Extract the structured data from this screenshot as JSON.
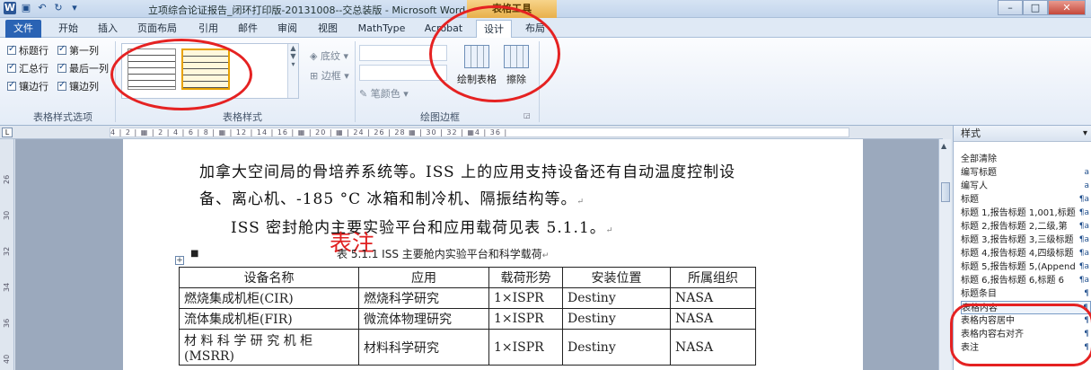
{
  "window": {
    "title": "立项综合论证报告_闭环打印版-20131008--交总装版 - Microsoft Word",
    "context_tab_title": "表格工具",
    "qat_icons": [
      "word-icon",
      "save-icon",
      "undo-icon",
      "redo-icon",
      "customize-icon"
    ]
  },
  "tabs": [
    {
      "label": "文件"
    },
    {
      "label": "开始"
    },
    {
      "label": "插入"
    },
    {
      "label": "页面布局"
    },
    {
      "label": "引用"
    },
    {
      "label": "邮件"
    },
    {
      "label": "审阅"
    },
    {
      "label": "视图"
    },
    {
      "label": "MathType"
    },
    {
      "label": "Acrobat"
    },
    {
      "label": "设计"
    },
    {
      "label": "布局"
    }
  ],
  "ribbon": {
    "style_options": {
      "label": "表格样式选项",
      "checks": [
        {
          "label": "标题行"
        },
        {
          "label": "第一列"
        },
        {
          "label": "汇总行"
        },
        {
          "label": "最后一列"
        },
        {
          "label": "镶边行"
        },
        {
          "label": "镶边列"
        }
      ]
    },
    "table_styles": {
      "label": "表格样式",
      "shading": "底纹",
      "borders": "边框"
    },
    "draw_borders": {
      "label": "绘图边框",
      "pen_color": "笔颜色",
      "draw_table": "绘制表格",
      "eraser": "擦除"
    }
  },
  "ruler_text": "4 | 2 |  ▦ | 2 | 4 | 6 | 8 |  ▦ | 12 | 14 | 16 |  ▦ | 20 |  ▦ | 24 | 26 | 28 ▦ | 30 | 32 |  ▦4 | 36 |",
  "vruler_labels": [
    "26",
    "30",
    "32",
    "34",
    "36",
    "40"
  ],
  "document": {
    "lines": [
      "加拿大空间局的骨培养系统等。ISS 上的应用支持设备还有自动温度控制设",
      "备、离心机、-185 °C 冰箱和制冷机、隔振结构等。",
      "ISS 密封舱内主要实验平台和应用载荷见表 5.1.1。"
    ],
    "annotation": "表注",
    "caption": "表 5.1.1 ISS 主要舱内实验平台和科学载荷",
    "table": {
      "headers": [
        "设备名称",
        "应用",
        "载荷形势",
        "安装位置",
        "所属组织"
      ],
      "rows": [
        [
          "燃烧集成机柜(CIR)",
          "燃烧科学研究",
          "1×ISPR",
          "Destiny",
          "NASA"
        ],
        [
          "流体集成机柜(FIR)",
          "微流体物理研究",
          "1×ISPR",
          "Destiny",
          "NASA"
        ],
        [
          "材 料 科 学 研 究 机 柜 (MSRR)",
          "材料科学研究",
          "1×ISPR",
          "Destiny",
          "NASA"
        ]
      ]
    }
  },
  "styles_pane": {
    "title": "样式",
    "items": [
      {
        "label": "全部清除",
        "mark": ""
      },
      {
        "label": "编写标题",
        "mark": "a"
      },
      {
        "label": "编写人",
        "mark": "a"
      },
      {
        "label": "标题",
        "mark": "¶a"
      },
      {
        "label": "标题 1,报告标题 1,001,标题",
        "mark": "¶a"
      },
      {
        "label": "标题 2,报告标题 2,二级,第",
        "mark": "¶a"
      },
      {
        "label": "标题 3,报告标题 3,三级标题",
        "mark": "¶a"
      },
      {
        "label": "标题 4,报告标题 4,四级标题",
        "mark": "¶a"
      },
      {
        "label": "标题 5,报告标题 5,(Append",
        "mark": "¶a"
      },
      {
        "label": "标题 6,报告标题 6,标题 6",
        "mark": "¶a"
      },
      {
        "label": "标题条目",
        "mark": "¶"
      },
      {
        "label": "表格内容",
        "mark": "¶"
      },
      {
        "label": "表格内容居中",
        "mark": "¶"
      },
      {
        "label": "表格内容右对齐",
        "mark": "¶"
      },
      {
        "label": "表注",
        "mark": "¶"
      }
    ]
  }
}
